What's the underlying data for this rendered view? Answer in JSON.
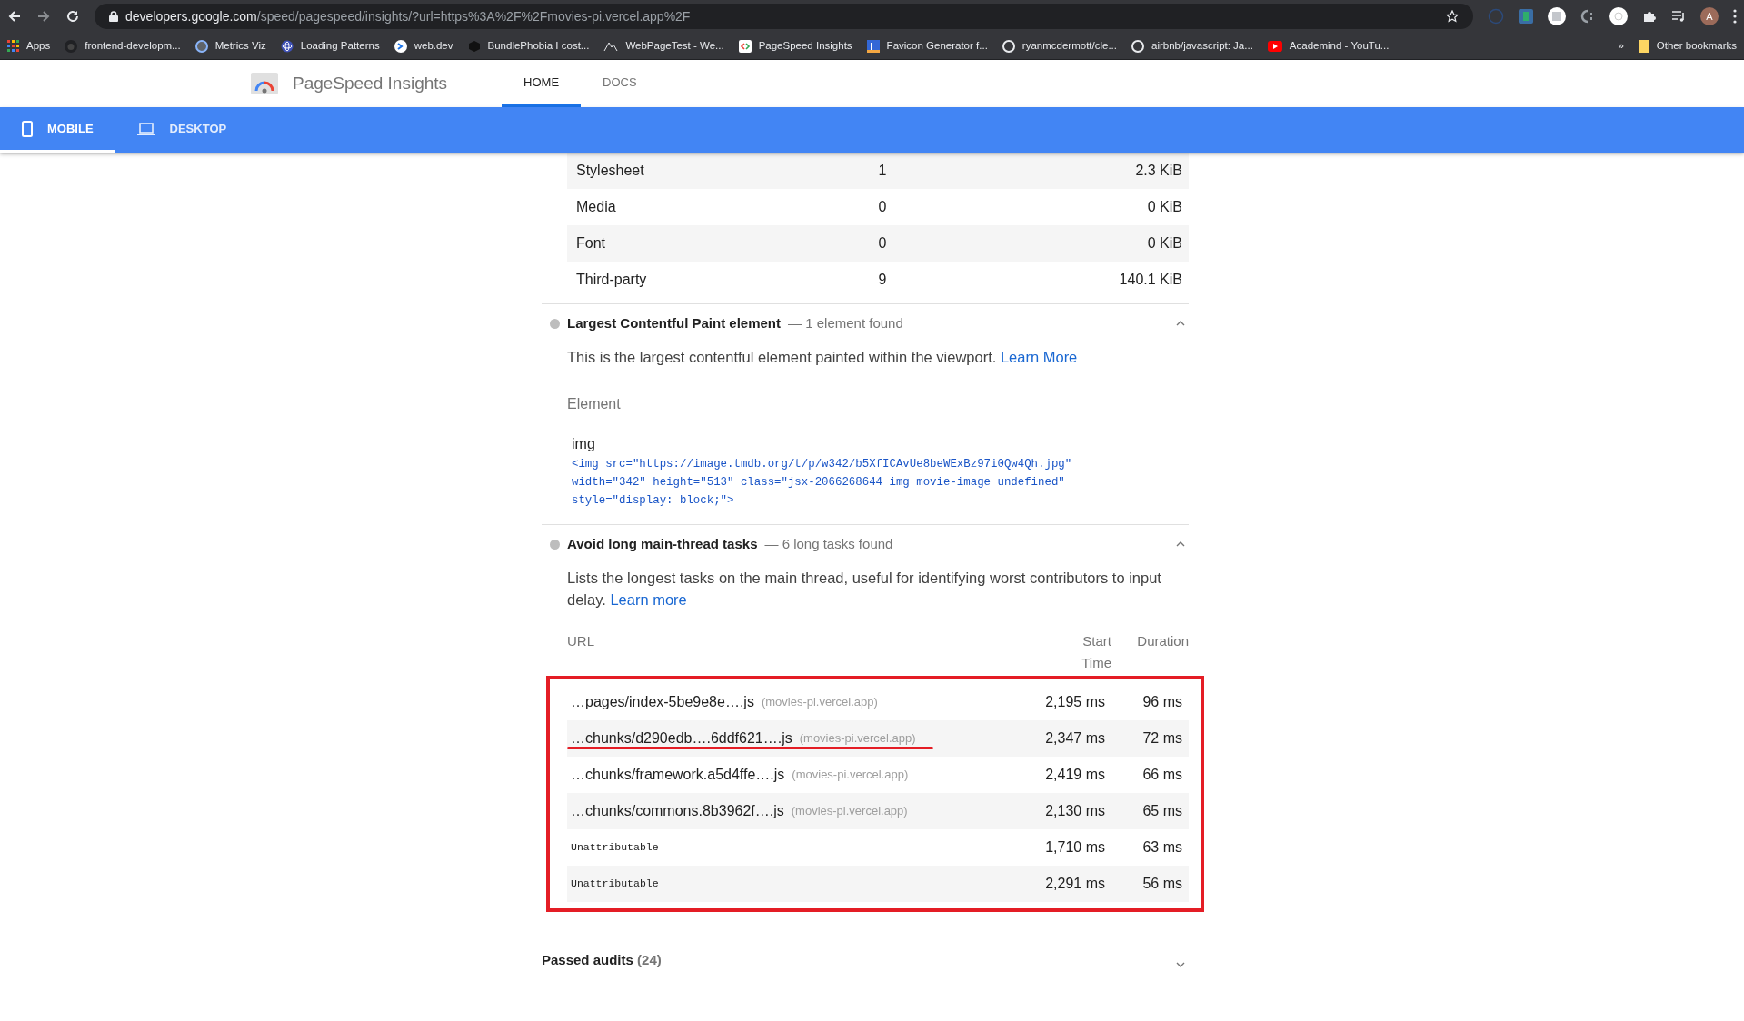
{
  "browser": {
    "url_host": "developers.google.com",
    "url_path": "/speed/pagespeed/insights/?url=https%3A%2F%2Fmovies-pi.vercel.app%2F",
    "profile_initial": "A",
    "bookmarks": [
      {
        "label": "Apps"
      },
      {
        "label": "frontend-developm..."
      },
      {
        "label": "Metrics Viz"
      },
      {
        "label": "Loading Patterns"
      },
      {
        "label": "web.dev"
      },
      {
        "label": "BundlePhobia I cost..."
      },
      {
        "label": "WebPageTest - We..."
      },
      {
        "label": "PageSpeed Insights"
      },
      {
        "label": "Favicon Generator f..."
      },
      {
        "label": "ryanmcdermott/cle..."
      },
      {
        "label": "airbnb/javascript: Ja..."
      },
      {
        "label": "Academind - YouTu..."
      }
    ],
    "more": "»",
    "other_bookmarks": "Other bookmarks"
  },
  "header": {
    "title": "PageSpeed Insights",
    "nav": [
      {
        "label": "HOME",
        "selected": true
      },
      {
        "label": "DOCS",
        "selected": false
      }
    ]
  },
  "device_tabs": [
    {
      "label": "MOBILE",
      "kind": "mobile",
      "selected": true
    },
    {
      "label": "DESKTOP",
      "kind": "desktop",
      "selected": false
    }
  ],
  "resource_table": {
    "rows": [
      {
        "type": "Stylesheet",
        "requests": "1",
        "size": "2.3 KiB"
      },
      {
        "type": "Media",
        "requests": "0",
        "size": "0 KiB"
      },
      {
        "type": "Font",
        "requests": "0",
        "size": "0 KiB"
      },
      {
        "type": "Third-party",
        "requests": "9",
        "size": "140.1 KiB"
      }
    ]
  },
  "audits": [
    {
      "kind": "element",
      "title": "Largest Contentful Paint element",
      "summary": "— 1 element found",
      "expanded": true,
      "description": "This is the largest contentful element painted within the viewport.",
      "link": "Learn More",
      "element_header": "Element",
      "element_label": "img",
      "snippet": "<img src=\"https://image.tmdb.org/t/p/w342/b5XfICAvUe8beWExBz97i0Qw4Qh.jpg\"\nwidth=\"342\" height=\"513\" class=\"jsx-2066268644 img movie-image undefined\"\nstyle=\"display: block;\">"
    },
    {
      "kind": "table",
      "title": "Avoid long main-thread tasks",
      "summary": "— 6 long tasks found",
      "expanded": true,
      "description": "Lists the longest tasks on the main thread, useful for identifying worst contributors to input delay.",
      "link": "Learn more",
      "columns": [
        "URL",
        "Start Time",
        "Duration"
      ],
      "rows": [
        {
          "kind": "url",
          "url": "…pages/index-5be9e8e….js",
          "host": "(movies-pi.vercel.app)",
          "start": "2,195 ms",
          "duration": "96 ms",
          "underlined": false
        },
        {
          "kind": "url",
          "url": "…chunks/d290edb….6ddf621….js",
          "host": "(movies-pi.vercel.app)",
          "start": "2,347 ms",
          "duration": "72 ms",
          "underlined": true
        },
        {
          "kind": "url",
          "url": "…chunks/framework.a5d4ffe….js",
          "host": "(movies-pi.vercel.app)",
          "start": "2,419 ms",
          "duration": "66 ms",
          "underlined": false
        },
        {
          "kind": "url",
          "url": "…chunks/commons.8b3962f….js",
          "host": "(movies-pi.vercel.app)",
          "start": "2,130 ms",
          "duration": "65 ms",
          "underlined": false
        },
        {
          "kind": "code",
          "url": "Unattributable",
          "start": "1,710 ms",
          "duration": "63 ms",
          "underlined": false
        },
        {
          "kind": "code",
          "url": "Unattributable",
          "start": "2,291 ms",
          "duration": "56 ms",
          "underlined": false
        }
      ]
    }
  ],
  "passed": {
    "label": "Passed audits",
    "count": "(24)",
    "expanded": false
  }
}
